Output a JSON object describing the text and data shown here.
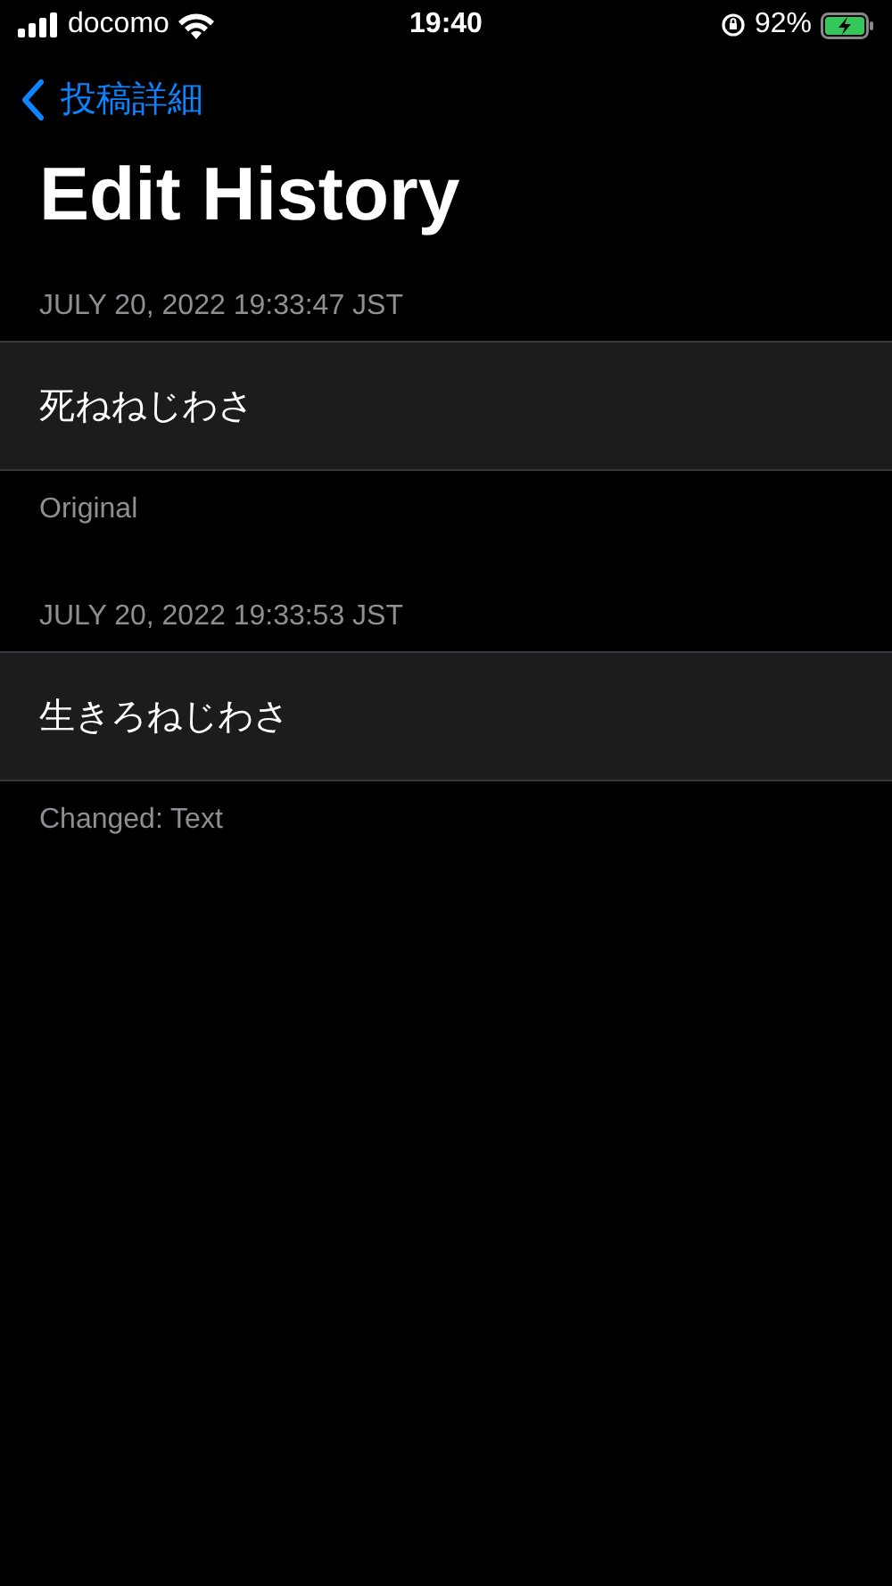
{
  "status_bar": {
    "carrier": "docomo",
    "time": "19:40",
    "battery": "92%"
  },
  "nav": {
    "back_label": "投稿詳細"
  },
  "title": "Edit History",
  "sections": [
    {
      "header": "JULY 20, 2022 19:33:47 JST",
      "text": "死ねねじわさ",
      "footer": "Original"
    },
    {
      "header": "JULY 20, 2022 19:33:53 JST",
      "text": "生きろねじわさ",
      "footer": "Changed: Text"
    }
  ]
}
